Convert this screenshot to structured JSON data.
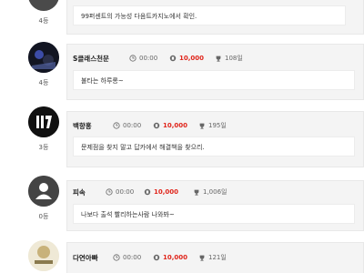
{
  "rows": [
    {
      "rank": "4등",
      "message": "99퍼센트의 가능성 다음트카지노에서 확인."
    },
    {
      "name": "S클래스천문",
      "time": "00:00",
      "coins": "10,000",
      "days": "108일",
      "rank": "4등",
      "message": "불타는 하루롱~"
    },
    {
      "name": "백향홍",
      "time": "00:00",
      "coins": "10,000",
      "days": "195일",
      "rank": "3등",
      "message": "문제점을 찾지 말고 답카에서 해결책을 찾으리."
    },
    {
      "name": "피속",
      "time": "00:00",
      "coins": "10,000",
      "days": "1,006일",
      "rank": "0등",
      "message": "나보다 출석 빨리하는사람 나와봐~"
    },
    {
      "name": "다연아빠",
      "time": "00:00",
      "coins": "10,000",
      "days": "121일"
    }
  ],
  "colors": {
    "coin": "#e0251b",
    "card_bg": "#f4f4f4"
  }
}
